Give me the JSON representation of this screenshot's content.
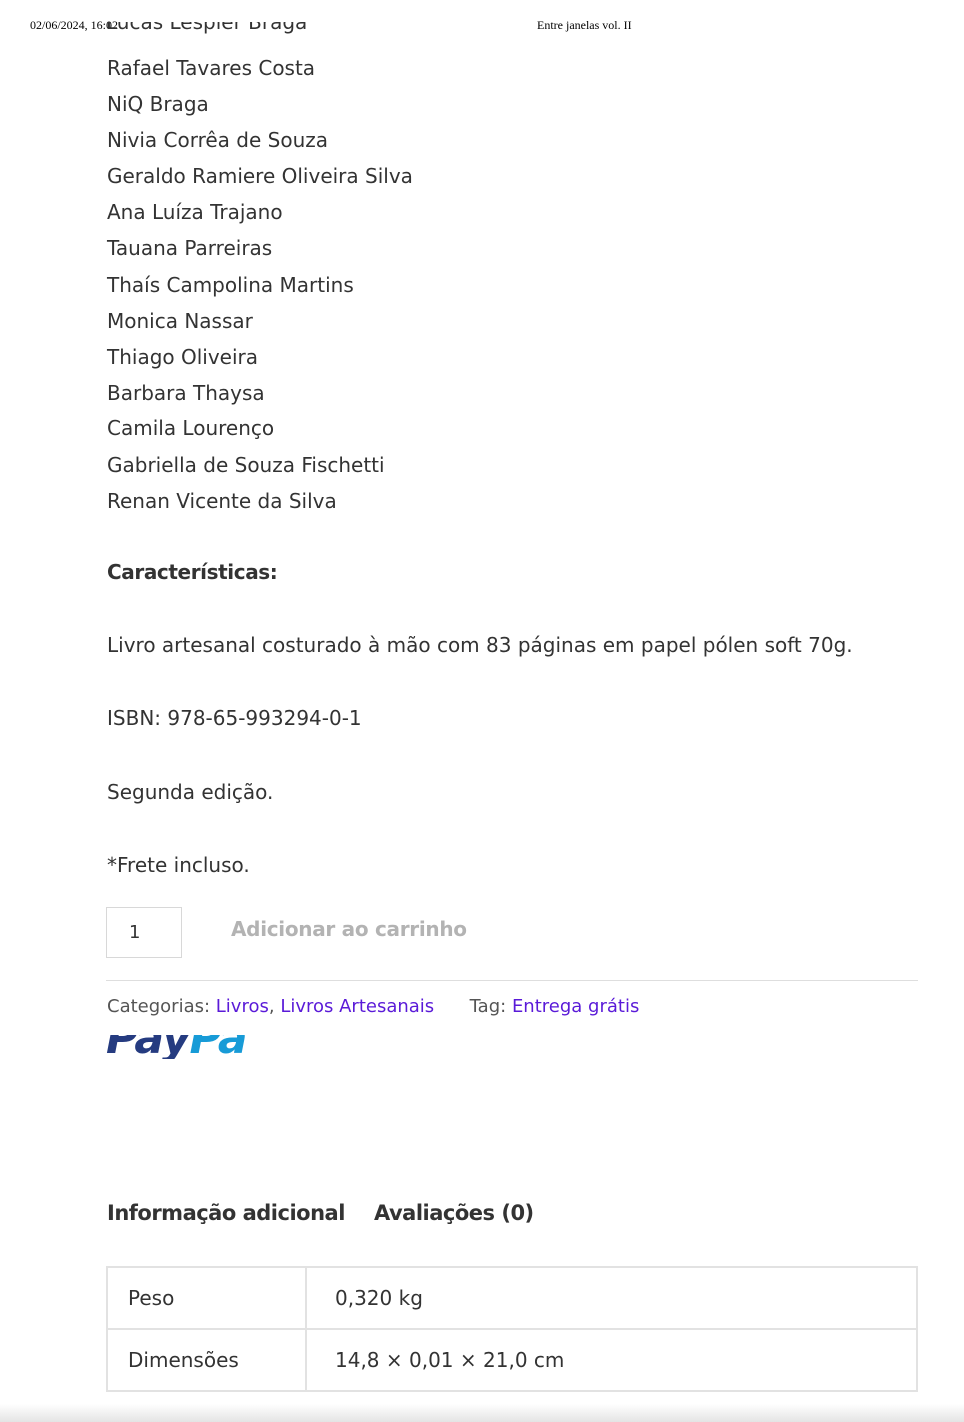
{
  "print_header": {
    "date": "02/06/2024, 16:02",
    "title": "Entre janelas vol. II"
  },
  "names": [
    "Rafael Tavares Costa",
    "NiQ Braga",
    "Nivia Corrêa de Souza",
    "Geraldo Ramiere Oliveira Silva",
    "Ana Luíza Trajano",
    "Tauana Parreiras",
    "Thaís Campolina Martins",
    "Monica Nassar",
    "Thiago Oliveira",
    "Barbara Thaysa",
    "Camila Lourenço",
    "Gabriella de Souza Fischetti",
    "Renan Vicente da Silva"
  ],
  "characteristics": {
    "heading": "Características:",
    "description": "Livro artesanal costurado à mão com 83 páginas em papel pólen soft 70g.",
    "isbn": "ISBN: 978-65-993294-0-1",
    "edition": "Segunda edição.",
    "shipping": "*Frete incluso."
  },
  "cart": {
    "quantity": "1",
    "add_label": "Adicionar ao carrinho"
  },
  "meta": {
    "categories_label": "Categorias:",
    "categories": [
      "Livros",
      "Livros Artesanais"
    ],
    "tag_label": "Tag:",
    "tag": "Entrega grátis"
  },
  "paypal": {
    "pay": "Pay",
    "pal": "Pal"
  },
  "tabs": [
    {
      "label": "Informação adicional"
    },
    {
      "label": "Avaliações (0)"
    }
  ],
  "attributes": [
    {
      "key": "Peso",
      "value": "0,320 kg"
    },
    {
      "key": "Dimensões",
      "value": "14,8 × 0,01 × 21,0 cm"
    }
  ],
  "colors": {
    "text": "#333333",
    "link": "#5a1ad8",
    "button_disabled": "#b3b3b3",
    "paypal_dark": "#253b80",
    "paypal_light": "#179bd7",
    "border": "#e2e2e2"
  }
}
